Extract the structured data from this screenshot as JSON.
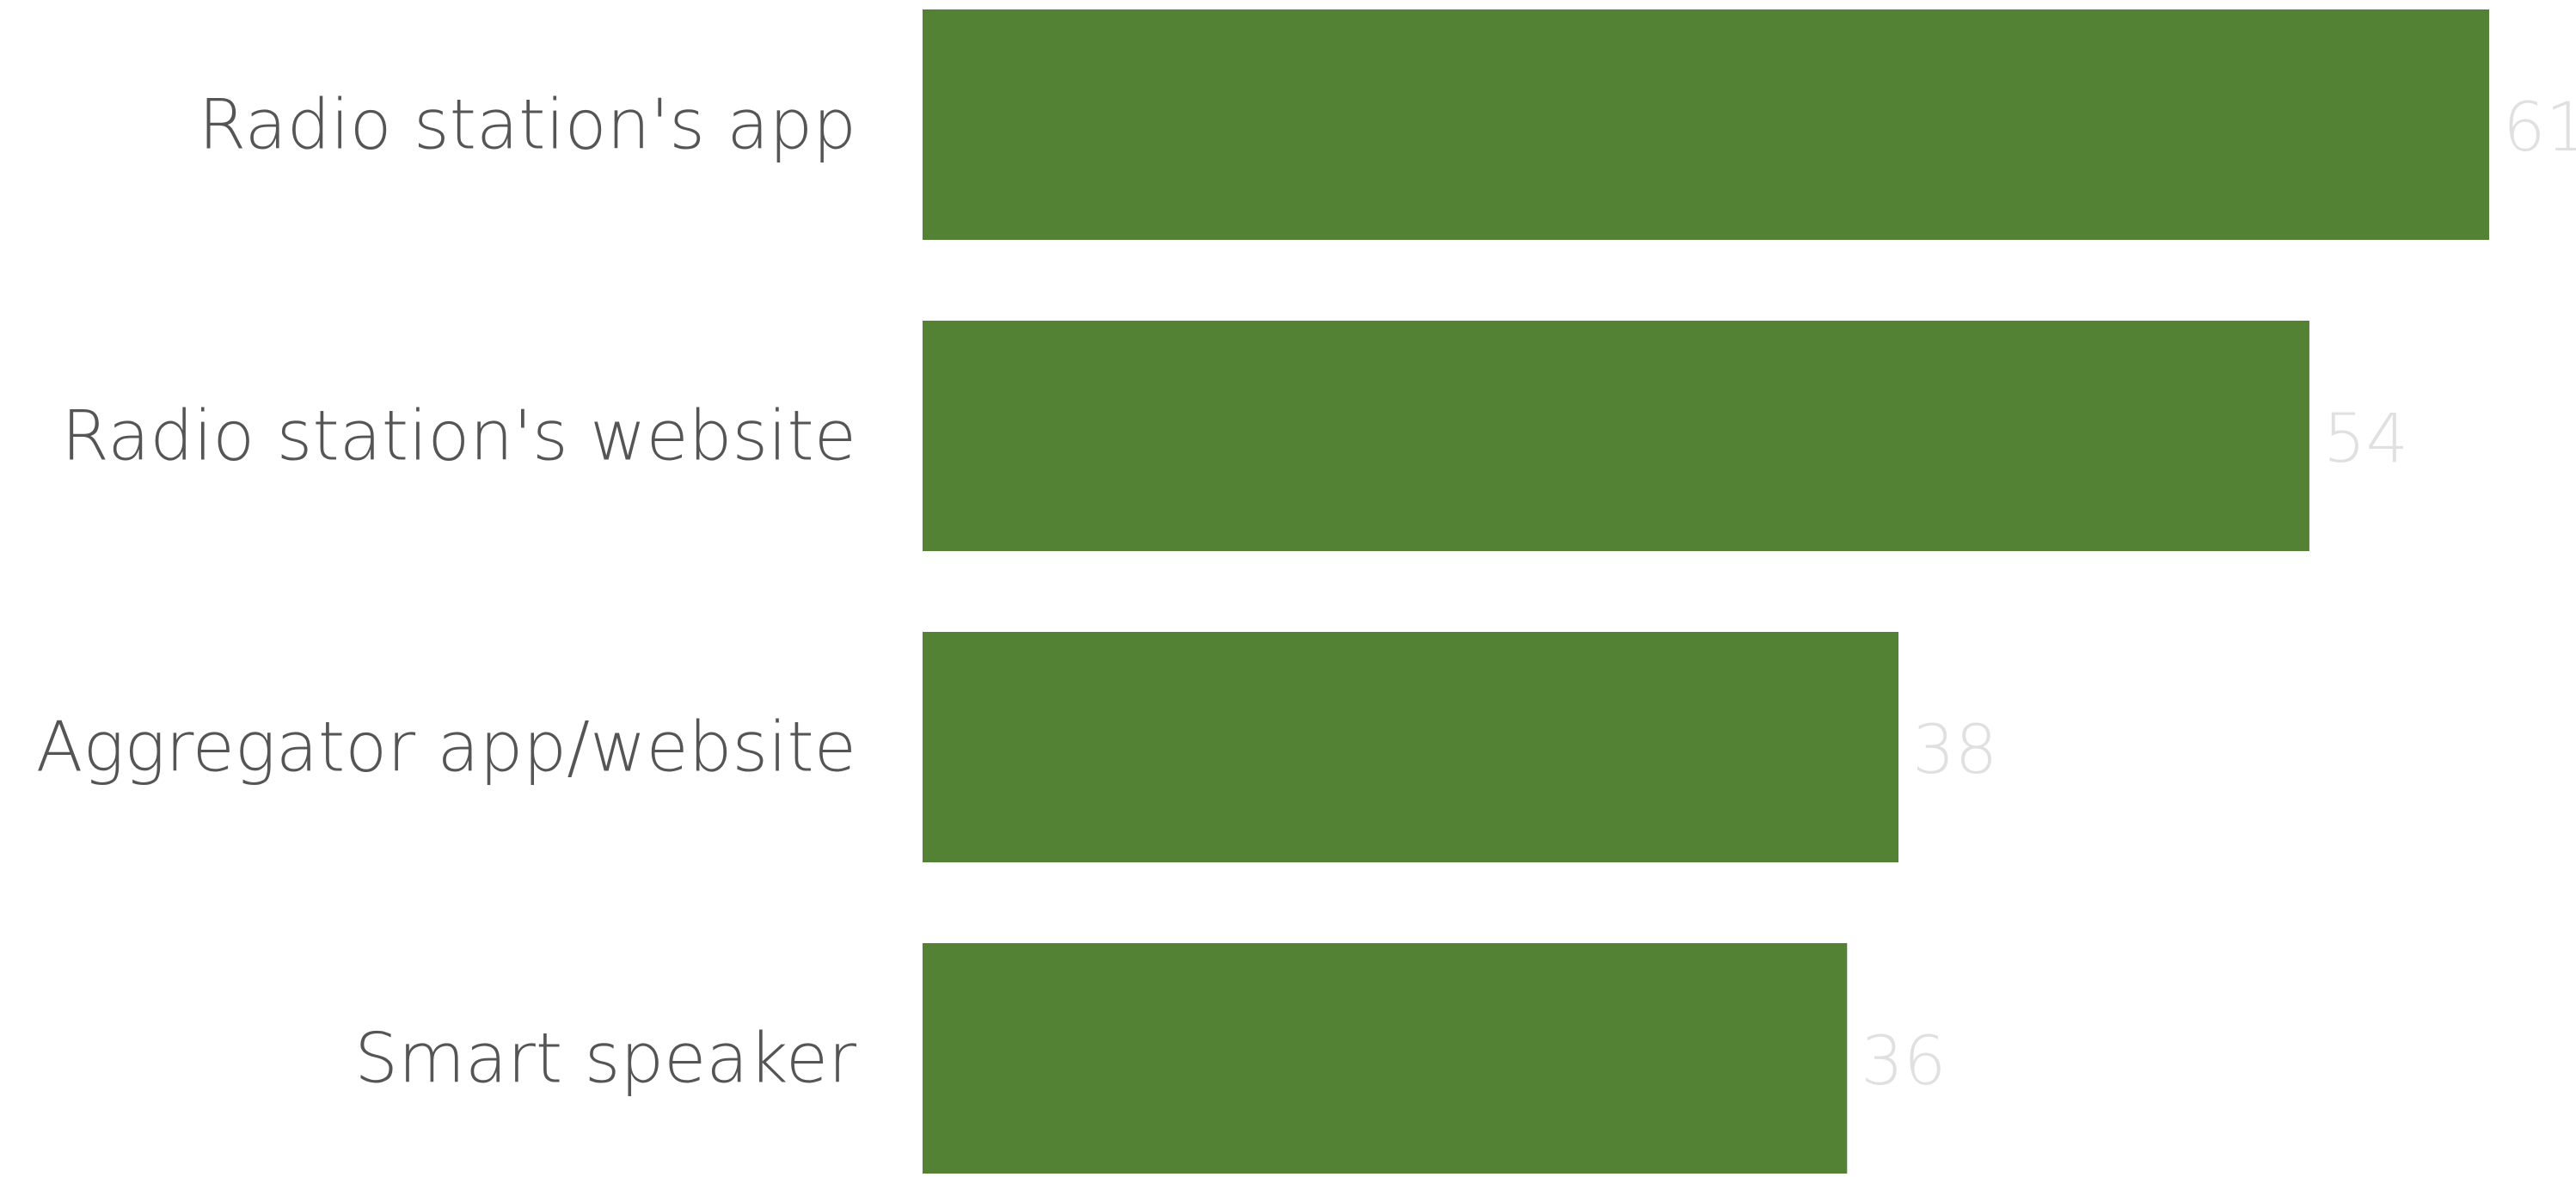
{
  "chart_data": {
    "type": "bar",
    "orientation": "horizontal",
    "title": "",
    "xlabel": "",
    "ylabel": "",
    "categories": [
      "Radio station's app",
      "Radio station's website",
      "Aggregator app/website",
      "Smart speaker"
    ],
    "values": [
      61,
      54,
      38,
      36
    ],
    "xlim": [
      0,
      61
    ],
    "grid": false,
    "legend": "none",
    "data_labels": true,
    "colors": {
      "bar": "#548235",
      "category_text": "#555555",
      "value_text": "#e0e0e0"
    }
  }
}
